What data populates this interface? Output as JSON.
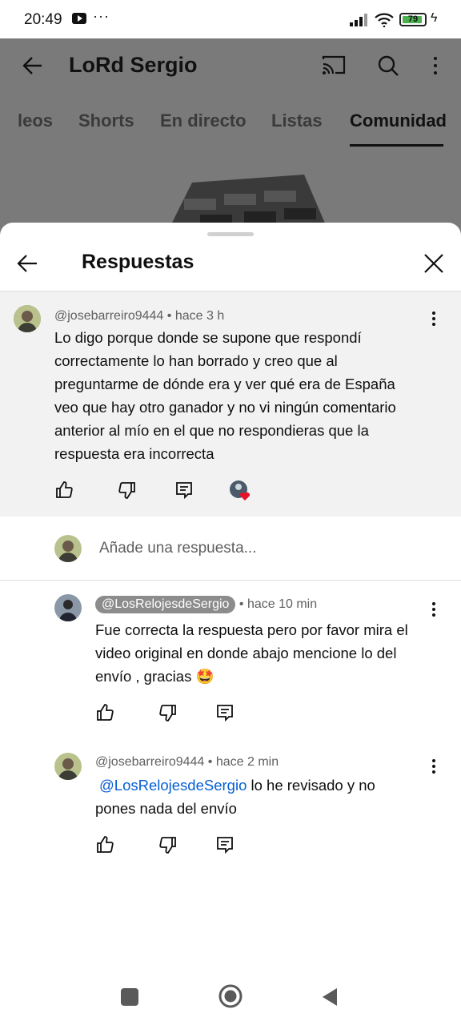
{
  "status_bar": {
    "time": "20:49",
    "battery": "79"
  },
  "channel": {
    "title": "LoRd Sergio"
  },
  "tabs": [
    "leos",
    "Shorts",
    "En directo",
    "Listas",
    "Comunidad"
  ],
  "sheet": {
    "title": "Respuestas"
  },
  "parent_comment": {
    "author": "@josebarreiro9444",
    "time": "hace 3 h",
    "lines": [
      "Lo digo porque donde se supone que respondí",
      "correctamente lo han borrado y creo que al",
      "preguntarme de dónde era y ver qué era de España",
      "veo que hay otro ganador y no vi ningún comentario",
      "anterior al mío en el que no respondieras que la",
      "respuesta era incorrecta"
    ]
  },
  "reply_input": {
    "placeholder": "Añade una respuesta..."
  },
  "replies": [
    {
      "author": "@LosRelojesdeSergio",
      "time": "hace 10 min",
      "lines": [
        "Fue correcta la respuesta pero por favor mira el",
        "video original en donde abajo mencione lo del",
        "envío , gracias 🤩"
      ]
    },
    {
      "author": "@josebarreiro9444",
      "time": "hace 2 min",
      "mention": "@LosRelojesdeSergio",
      "line1_rest": " lo he revisado y no",
      "line2": "pones nada del envío"
    }
  ],
  "separators": {
    "dot": " • "
  },
  "icons": [
    "back-arrow-icon",
    "cast-icon",
    "search-icon",
    "more-vert-icon",
    "close-icon",
    "like-icon",
    "dislike-icon",
    "reply-icon",
    "creator-heart-icon",
    "nav-square-icon",
    "nav-home-icon",
    "nav-back-icon"
  ]
}
